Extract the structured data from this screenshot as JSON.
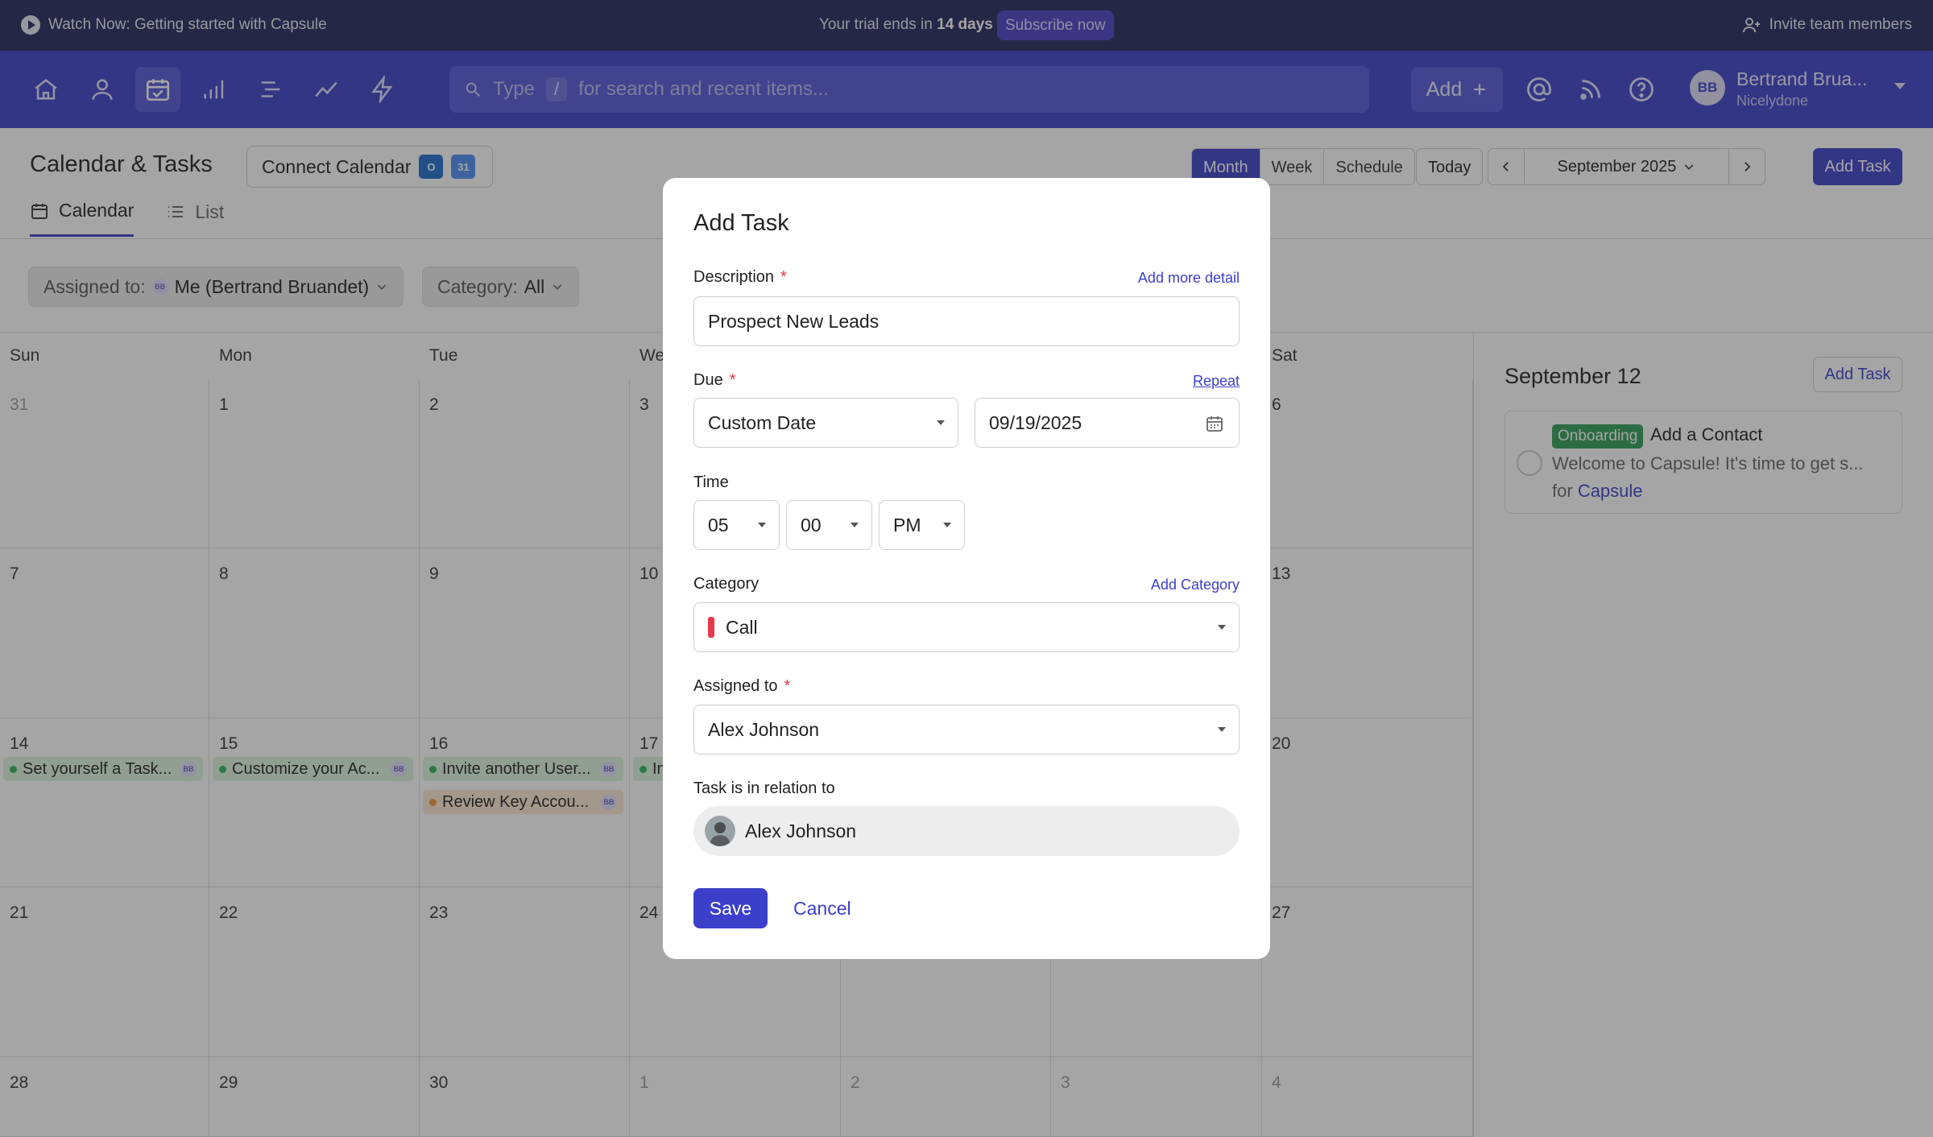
{
  "trial_bar": {
    "watch_text": "Watch Now: Getting started with Capsule",
    "trial_prefix": "Your trial ends in",
    "trial_days": "14 days",
    "subscribe": "Subscribe now",
    "invite": "Invite team members"
  },
  "navbar": {
    "search_type": "Type",
    "search_slash": "/",
    "search_placeholder": "for search and recent items...",
    "add_label": "Add",
    "user_initials": "BB",
    "user_name": "Bertrand Brua...",
    "user_org": "Nicelydone"
  },
  "header": {
    "title": "Calendar & Tasks",
    "connect_calendar": "Connect Calendar",
    "outlook_letter": "O",
    "google_number": "31",
    "views": [
      "Month",
      "Week",
      "Schedule"
    ],
    "active_view": "Month",
    "today": "Today",
    "month_label": "September 2025",
    "add_task": "Add Task",
    "tabs": [
      "Calendar",
      "List"
    ],
    "filters": {
      "assigned_label": "Assigned to:",
      "assigned_initials": "BB",
      "assigned_value": "Me (Bertrand Bruandet)",
      "category_label": "Category:",
      "category_value": "All"
    }
  },
  "calendar": {
    "day_headers": [
      "Sun",
      "Mon",
      "Tue",
      "We",
      "",
      "",
      "Sat"
    ],
    "weeks": [
      [
        "31",
        "1",
        "2",
        "3",
        "",
        "",
        "6"
      ],
      [
        "7",
        "8",
        "9",
        "10",
        "",
        "",
        "13"
      ],
      [
        "14",
        "15",
        "16",
        "17",
        "",
        "",
        "20"
      ],
      [
        "21",
        "22",
        "23",
        "24",
        "",
        "",
        "27"
      ],
      [
        "28",
        "29",
        "30",
        "1",
        "2",
        "3",
        "4"
      ]
    ],
    "events": {
      "sun14": {
        "title": "Set yourself a Task...",
        "initials": "BB"
      },
      "mon15": {
        "title": "Customize your Ac...",
        "initials": "BB"
      },
      "tue16a": {
        "title": "Invite another User...",
        "initials": "BB"
      },
      "tue16b": {
        "title": "Review Key Accou...",
        "initials": "BB"
      },
      "wed17": {
        "title": "In"
      }
    }
  },
  "side_panel": {
    "date_title": "September 12",
    "add_task": "Add Task",
    "task": {
      "badge": "Onboarding",
      "title": "Add a Contact",
      "description": "Welcome to Capsule! It's time to get s...",
      "for_prefix": "for",
      "for_link": "Capsule"
    }
  },
  "modal": {
    "title": "Add Task",
    "description_label": "Description",
    "required_mark": "*",
    "add_more_detail": "Add more detail",
    "description_value": "Prospect New Leads",
    "due_label": "Due",
    "repeat": "Repeat",
    "due_type": "Custom Date",
    "due_date": "09/19/2025",
    "time_label": "Time",
    "time_hour": "05",
    "time_minute": "00",
    "time_ampm": "PM",
    "category_label": "Category",
    "add_category": "Add Category",
    "category_value": "Call",
    "category_color": "#e8394d",
    "assigned_label": "Assigned to",
    "assigned_value": "Alex Johnson",
    "relation_label": "Task is in relation to",
    "relation_value": "Alex Johnson",
    "save": "Save",
    "cancel": "Cancel"
  },
  "colors": {
    "brand": "#3b3fc9",
    "trial_bar": "#23265d",
    "event_green": "#2bb35a",
    "event_orange": "#ee9a35",
    "onboarding_badge": "#2f9d57"
  }
}
